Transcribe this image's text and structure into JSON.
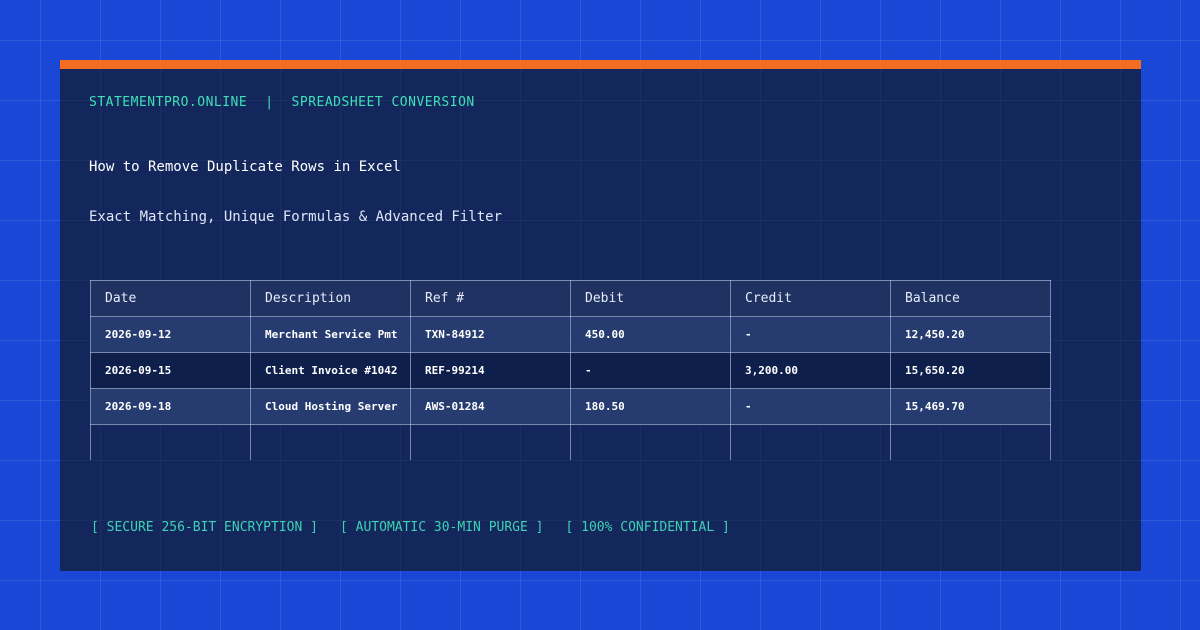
{
  "brand": {
    "site": "STATEMENTPRO.ONLINE",
    "separator": "|",
    "section": "SPREADSHEET CONVERSION"
  },
  "title": "How to Remove Duplicate Rows in Excel",
  "subtitle": "Exact Matching, Unique Formulas & Advanced Filter",
  "table": {
    "headers": [
      "Date",
      "Description",
      "Ref #",
      "Debit",
      "Credit",
      "Balance"
    ],
    "rows": [
      {
        "date": "2026-09-12",
        "description": "Merchant Service Pmt",
        "ref": "TXN-84912",
        "debit": "450.00",
        "credit": "-",
        "balance": "12,450.20"
      },
      {
        "date": "2026-09-15",
        "description": "Client Invoice #1042",
        "ref": "REF-99214",
        "debit": "-",
        "credit": "3,200.00",
        "balance": "15,650.20"
      },
      {
        "date": "2026-09-18",
        "description": "Cloud Hosting Server",
        "ref": "AWS-01284",
        "debit": "180.50",
        "credit": "-",
        "balance": "15,469.70"
      }
    ]
  },
  "badges": [
    "[ SECURE 256-BIT ENCRYPTION ]",
    "[ AUTOMATIC 30-MIN PURGE ]",
    "[ 100% CONFIDENTIAL ]"
  ],
  "colors": {
    "background": "#1a47d6",
    "card": "#13275c",
    "accent": "#f26d21",
    "brand_text": "#3fe0b6",
    "debit": "#ff7a7a",
    "credit": "#3fe0b6"
  }
}
